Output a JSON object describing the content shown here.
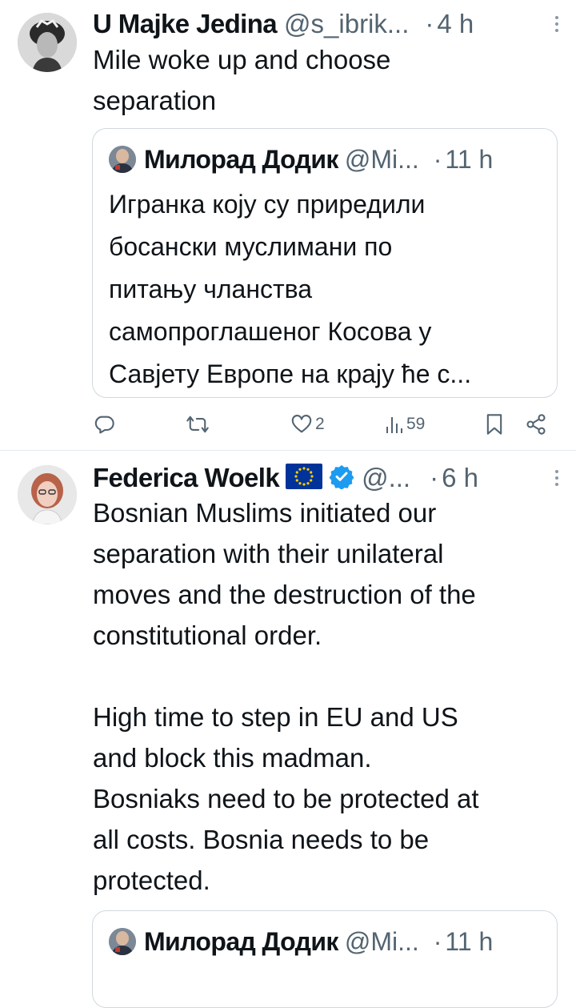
{
  "tweets": [
    {
      "display_name": "U Majke Jedina",
      "handle": "@s_ibrik...",
      "dot": "·",
      "time": "4 h",
      "text": "Mile woke up and choose\nseparation",
      "quote": {
        "display_name": "Милорад Додик",
        "handle": "@Mi...",
        "dot": "·",
        "time": "11 h",
        "text": "Игранка коју су приредили\nбосански муслимани по\nпитању чланства\nсамопроглашеног Косова у\nСавјету Европе на крају ће с..."
      },
      "actions": {
        "reply_count": "",
        "retweet_count": "",
        "like_count": "2",
        "view_count": "59"
      }
    },
    {
      "display_name": "Federica Woelk",
      "handle": "@...",
      "dot": "·",
      "time": "6 h",
      "verified": true,
      "text": "Bosnian Muslims initiated our\nseparation with their unilateral\nmoves and the destruction of the\nconstitutional order.\n\nHigh time to step in EU and US\nand block this madman.\nBosniaks need to be protected at\nall costs. Bosnia needs to be\nprotected.",
      "quote": {
        "display_name": "Милорад Додик",
        "handle": "@Mi...",
        "dot": "·",
        "time": "11 h"
      }
    }
  ],
  "colors": {
    "text": "#0f1419",
    "secondary": "#536471",
    "verified": "#1d9bf0",
    "eu_blue": "#003399",
    "eu_star": "#ffcc00",
    "border": "#cfd9de"
  },
  "icons": [
    "reply-icon",
    "retweet-icon",
    "like-icon",
    "views-icon",
    "bookmark-icon",
    "share-icon",
    "more-icon",
    "verified-icon",
    "eu-flag-icon"
  ]
}
